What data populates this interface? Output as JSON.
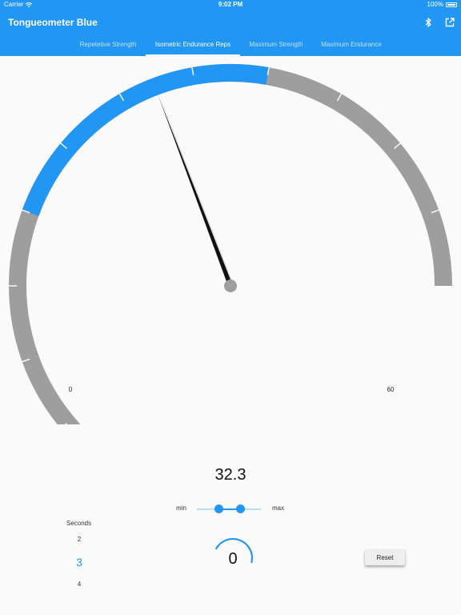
{
  "status_bar": {
    "carrier": "Carrier",
    "time": "9:02 PM",
    "battery": "100%"
  },
  "app_bar": {
    "title": "Tongueometer Blue"
  },
  "tabs": [
    {
      "label": "Repetetive Strength"
    },
    {
      "label": "Isometric Endurance Reps",
      "active": true
    },
    {
      "label": "Maximum Strength"
    },
    {
      "label": "Maximum Endurance"
    }
  ],
  "gauge": {
    "min_label": "0",
    "max_label": "60",
    "range_min": 0,
    "range_max": 60,
    "highlight_start": 20,
    "highlight_end": 40,
    "needle_value": 32.3,
    "track_color": "#9e9e9e",
    "highlight_color": "#2196f3"
  },
  "reading": {
    "value": "32.3"
  },
  "range_slider": {
    "min_label": "min",
    "max_label": "max",
    "low_fraction": 0.34,
    "high_fraction": 0.68
  },
  "seconds_picker": {
    "title": "Seconds",
    "items": [
      "2",
      "3",
      "4"
    ],
    "selected_index": 1
  },
  "timer": {
    "value": "0",
    "progress_fraction": 0.45
  },
  "reset_button": {
    "label": "Reset"
  },
  "colors": {
    "accent": "#2196f3"
  }
}
